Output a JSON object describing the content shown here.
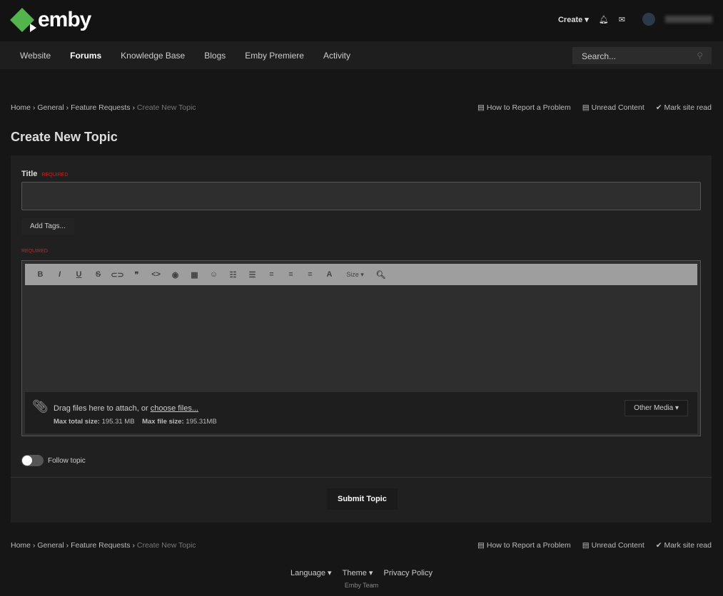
{
  "header": {
    "logo": "emby",
    "create": "Create ▾",
    "username": "member"
  },
  "nav": {
    "items": [
      "Website",
      "Forums",
      "Knowledge Base",
      "Blogs",
      "Emby Premiere",
      "Activity"
    ],
    "search_placeholder": "Search..."
  },
  "breadcrumb": [
    "Home",
    "General",
    "Feature Requests",
    "Create New Topic"
  ],
  "quick_links": [
    "How to Report a Problem",
    "Unread Content",
    "Mark site read"
  ],
  "page_title": "Create New Topic",
  "form": {
    "title_label": "Title",
    "required": "REQUIRED",
    "add_tags": "Add Tags...",
    "size": "Size ▾",
    "drag_text": "Drag files here to attach, or ",
    "choose_files": "choose files...",
    "max_total_label": "Max total size:",
    "max_total": "195.31 MB",
    "max_file_label": "Max file size:",
    "max_file": "195.31MB",
    "other_media": "Other Media ▾",
    "follow": "Follow topic",
    "submit": "Submit Topic"
  },
  "footer": {
    "language": "Language ▾",
    "theme": "Theme ▾",
    "privacy": "Privacy Policy",
    "team": "Emby Team"
  }
}
